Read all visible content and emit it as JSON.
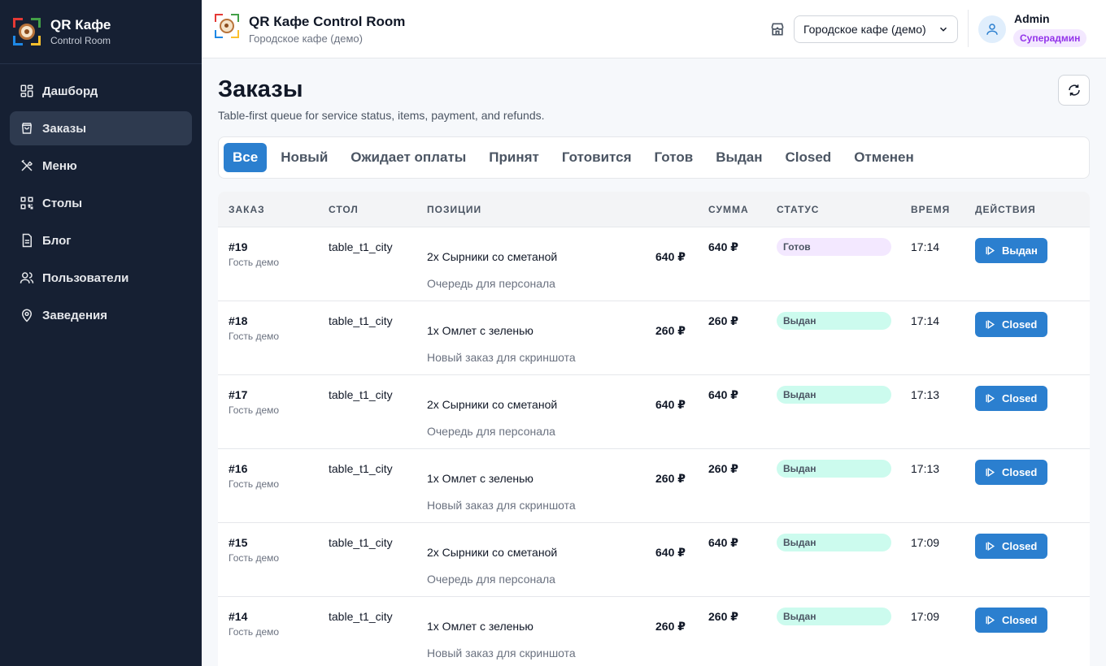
{
  "sidebar": {
    "brand_title": "QR Кафе",
    "brand_sub": "Control Room",
    "items": [
      {
        "label": "Дашборд",
        "icon": "dashboard-icon",
        "active": false
      },
      {
        "label": "Заказы",
        "icon": "bag-icon",
        "active": true
      },
      {
        "label": "Меню",
        "icon": "utensils-icon",
        "active": false
      },
      {
        "label": "Столы",
        "icon": "qr-code-icon",
        "active": false
      },
      {
        "label": "Блог",
        "icon": "document-icon",
        "active": false
      },
      {
        "label": "Пользователи",
        "icon": "users-icon",
        "active": false
      },
      {
        "label": "Заведения",
        "icon": "map-pin-icon",
        "active": false
      }
    ]
  },
  "topbar": {
    "title": "QR Кафе Control Room",
    "subtitle": "Городское кафе (демо)",
    "venue_selected": "Городское кафе (демо)",
    "user_name": "Admin",
    "user_role": "Суперадмин"
  },
  "page": {
    "title": "Заказы",
    "subtitle": "Table-first queue for service status, items, payment, and refunds."
  },
  "tabs": [
    {
      "label": "Все",
      "active": true
    },
    {
      "label": "Новый",
      "active": false
    },
    {
      "label": "Ожидает оплаты",
      "active": false
    },
    {
      "label": "Принят",
      "active": false
    },
    {
      "label": "Готовится",
      "active": false
    },
    {
      "label": "Готов",
      "active": false
    },
    {
      "label": "Выдан",
      "active": false
    },
    {
      "label": "Closed",
      "active": false
    },
    {
      "label": "Отменен",
      "active": false
    }
  ],
  "table": {
    "columns": {
      "order": "ЗАКАЗ",
      "table": "СТОЛ",
      "items": "ПОЗИЦИИ",
      "sum": "СУММА",
      "status": "СТАТУС",
      "time": "ВРЕМЯ",
      "actions": "ДЕЙСТВИЯ"
    },
    "rows": [
      {
        "id": "#19",
        "guest": "Гость демо",
        "table": "table_t1_city",
        "item": "2x Сырники со сметаной",
        "item_price": "640 ₽",
        "note": "Очередь для персонала",
        "sum": "640 ₽",
        "status": "Готов",
        "status_kind": "ready",
        "time": "17:14",
        "action": "Выдан"
      },
      {
        "id": "#18",
        "guest": "Гость демо",
        "table": "table_t1_city",
        "item": "1x Омлет с зеленью",
        "item_price": "260 ₽",
        "note": "Новый заказ для скриншота",
        "sum": "260 ₽",
        "status": "Выдан",
        "status_kind": "given",
        "time": "17:14",
        "action": "Closed"
      },
      {
        "id": "#17",
        "guest": "Гость демо",
        "table": "table_t1_city",
        "item": "2x Сырники со сметаной",
        "item_price": "640 ₽",
        "note": "Очередь для персонала",
        "sum": "640 ₽",
        "status": "Выдан",
        "status_kind": "given",
        "time": "17:13",
        "action": "Closed"
      },
      {
        "id": "#16",
        "guest": "Гость демо",
        "table": "table_t1_city",
        "item": "1x Омлет с зеленью",
        "item_price": "260 ₽",
        "note": "Новый заказ для скриншота",
        "sum": "260 ₽",
        "status": "Выдан",
        "status_kind": "given",
        "time": "17:13",
        "action": "Closed"
      },
      {
        "id": "#15",
        "guest": "Гость демо",
        "table": "table_t1_city",
        "item": "2x Сырники со сметаной",
        "item_price": "640 ₽",
        "note": "Очередь для персонала",
        "sum": "640 ₽",
        "status": "Выдан",
        "status_kind": "given",
        "time": "17:09",
        "action": "Closed"
      },
      {
        "id": "#14",
        "guest": "Гость демо",
        "table": "table_t1_city",
        "item": "1x Омлет с зеленью",
        "item_price": "260 ₽",
        "note": "Новый заказ для скриншота",
        "sum": "260 ₽",
        "status": "Выдан",
        "status_kind": "given",
        "time": "17:09",
        "action": "Closed"
      }
    ]
  },
  "colors": {
    "sidebar_bg": "#162033",
    "accent": "#2b7fcf",
    "status_ready": "#f3e8ff",
    "status_given": "#ccfbee",
    "role_badge": "#9333ea"
  }
}
